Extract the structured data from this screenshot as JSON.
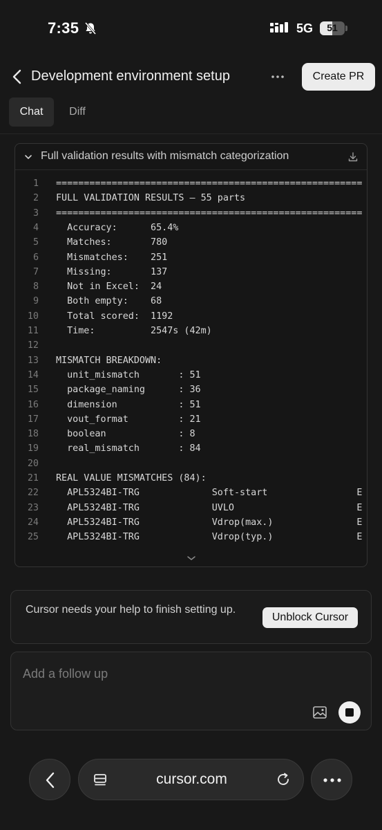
{
  "status_bar": {
    "time": "7:35",
    "network": "5G",
    "battery_level": "51",
    "battery_fraction": 0.51
  },
  "header": {
    "title": "Development environment setup",
    "create_pr_label": "Create PR"
  },
  "tabs": [
    {
      "label": "Chat",
      "active": true
    },
    {
      "label": "Diff",
      "active": false
    }
  ],
  "code_card": {
    "title": "Full validation results with mismatch categorization",
    "lines": [
      {
        "n": "1",
        "text": "======================================================="
      },
      {
        "n": "2",
        "text": "FULL VALIDATION RESULTS — 55 parts"
      },
      {
        "n": "3",
        "text": "======================================================="
      },
      {
        "n": "4",
        "text": "  Accuracy:      65.4%"
      },
      {
        "n": "5",
        "text": "  Matches:       780"
      },
      {
        "n": "6",
        "text": "  Mismatches:    251"
      },
      {
        "n": "7",
        "text": "  Missing:       137"
      },
      {
        "n": "8",
        "text": "  Not in Excel:  24"
      },
      {
        "n": "9",
        "text": "  Both empty:    68"
      },
      {
        "n": "10",
        "text": "  Total scored:  1192"
      },
      {
        "n": "11",
        "text": "  Time:          2547s (42m)"
      },
      {
        "n": "12",
        "text": ""
      },
      {
        "n": "13",
        "text": "MISMATCH BREAKDOWN:"
      },
      {
        "n": "14",
        "text": "  unit_mismatch       : 51"
      },
      {
        "n": "15",
        "text": "  package_naming      : 36"
      },
      {
        "n": "16",
        "text": "  dimension           : 51"
      },
      {
        "n": "17",
        "text": "  vout_format         : 21"
      },
      {
        "n": "18",
        "text": "  boolean             : 8"
      },
      {
        "n": "19",
        "text": "  real_mismatch       : 84"
      },
      {
        "n": "20",
        "text": ""
      },
      {
        "n": "21",
        "text": "REAL VALUE MISMATCHES (84):"
      },
      {
        "n": "22",
        "text": "  APL5324BI-TRG             Soft-start                E"
      },
      {
        "n": "23",
        "text": "  APL5324BI-TRG             UVLO                      E"
      },
      {
        "n": "24",
        "text": "  APL5324BI-TRG             Vdrop(max.)               E"
      },
      {
        "n": "25",
        "text": "  APL5324BI-TRG             Vdrop(typ.)               E"
      }
    ]
  },
  "banner": {
    "message": "Cursor needs your help to finish setting up.",
    "button_label": "Unblock Cursor"
  },
  "followup": {
    "placeholder": "Add a follow up",
    "value": ""
  },
  "browser": {
    "url": "cursor.com"
  },
  "colors": {
    "background": "#181818",
    "button_light": "#ececec",
    "border": "#343434"
  }
}
